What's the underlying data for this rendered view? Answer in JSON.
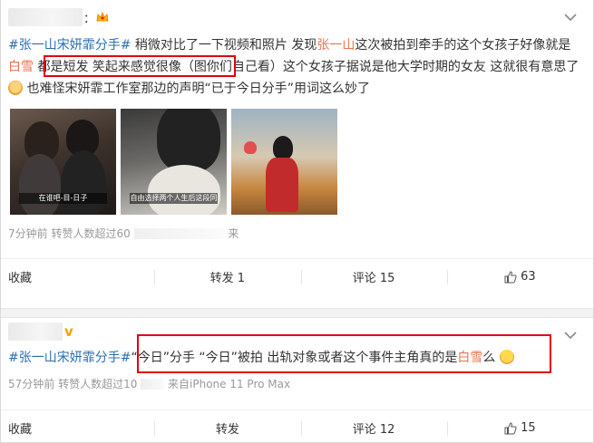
{
  "colors": {
    "hashtag": "#eb7350",
    "link": "#2c6eb2",
    "highlight_box": "#e0000e",
    "meta": "#999999"
  },
  "posts": [
    {
      "name_suffix": "：",
      "text": {
        "hashtag": "#张一山宋妍霏分手#",
        "part1": " 稍微对比了一下视频和照片 发现",
        "mention": "张一山",
        "part2": "这次被拍到牵手的这个女孩子好像就是",
        "highlight": "白雪",
        "part3": " 都是短发 笑起来感觉很像（图你们自己看）这个女孩子据说是他大学时期的女友 这就很有意思了",
        "part4": " 也难怪宋妍霏工作室那边的声明“已于今日分手”用词这么妙了"
      },
      "images": [
        {
          "icon": "photo-couple-night",
          "caption": "在谁吧-目-日子"
        },
        {
          "icon": "photo-girl-closeup",
          "caption": "自由选择两个人生后这段同"
        },
        {
          "icon": "photo-girl-balcony",
          "caption": ""
        }
      ],
      "meta": "7分钟前 转赞人数超过60",
      "meta_extra": "来",
      "actions": {
        "favorite": "收藏",
        "repost": "转发 1",
        "comment": "评论 15",
        "like_count": "63"
      }
    },
    {
      "text": {
        "hashtag": "#张一山宋妍霏分手#",
        "part1": "“今日”分手 “今日”被拍 出轨对象或者这个事件主角真的是",
        "highlight": "白雪",
        "part2": "么"
      },
      "meta": "57分钟前 转赞人数超过10",
      "meta_extra": "来自iPhone 11 Pro Max",
      "actions": {
        "favorite": "收藏",
        "repost": "转发",
        "comment": "评论 12",
        "like_count": "15"
      }
    }
  ]
}
